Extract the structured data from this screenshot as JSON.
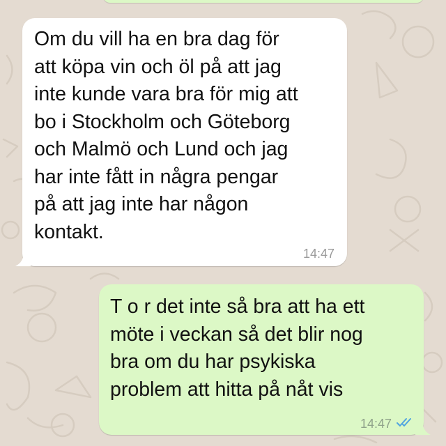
{
  "chat": {
    "messages": [
      {
        "direction": "incoming",
        "text": "Om du vill ha en bra dag för\natt köpa vin och öl på att jag\ninte kunde vara bra för mig att\nbo i Stockholm och Göteborg\noch Malmö och Lund och jag\nhar inte fått in några pengar\npå att jag inte har någon\nkontakt.",
        "time": "14:47"
      },
      {
        "direction": "outgoing",
        "text": "T o r det inte så bra att ha ett\nmöte i veckan så det blir nog\nbra om du har psykiska\nproblem att hitta på nåt vis",
        "time": "14:47",
        "status_icon": "double-check-read-icon"
      }
    ]
  },
  "colors": {
    "wallpaper": "#e4dbd1",
    "incoming_bubble": "#ffffff",
    "outgoing_bubble": "#dcf8c6",
    "read_ticks": "#4fa3e0"
  }
}
